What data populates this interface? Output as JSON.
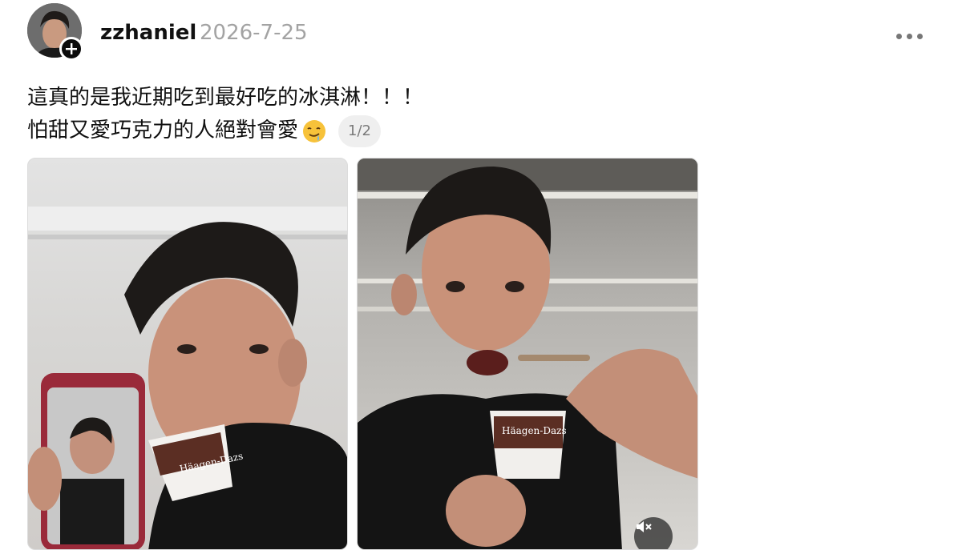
{
  "post": {
    "username": "zzhaniel",
    "date": "2026-7-25",
    "text_line1": "這真的是我近期吃到最好吃的冰淇淋！！！",
    "text_line2": "怕甜又愛巧克力的人絕對會愛",
    "emoji": "drooling-face",
    "page_indicator": "1/2"
  },
  "icons": {
    "follow": "plus-icon",
    "more": "more-horizontal-icon",
    "mute": "speaker-muted-icon"
  },
  "media": [
    {
      "type": "photo",
      "description_name": "selfie-with-ice-cream"
    },
    {
      "type": "video",
      "description_name": "eating-ice-cream-video"
    }
  ],
  "cup_label": "Häagen-Dazs"
}
